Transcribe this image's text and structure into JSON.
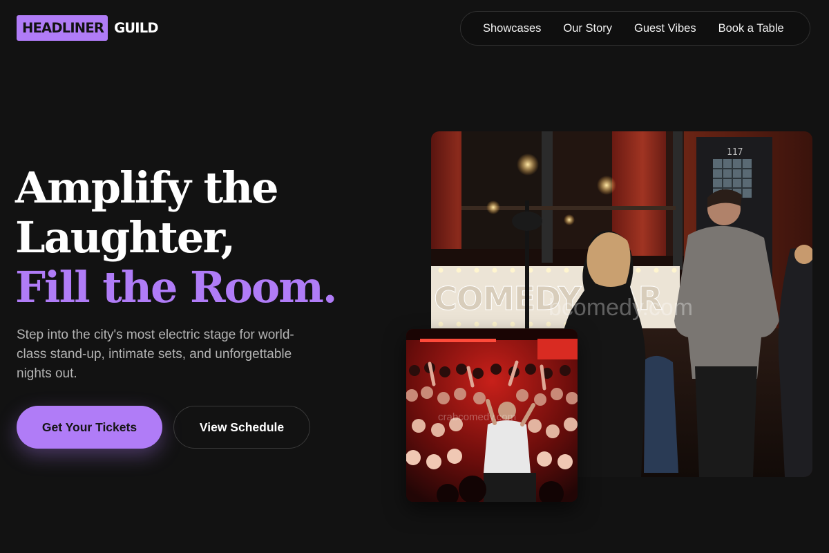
{
  "brand": {
    "highlight": "HEADLINER",
    "name": "GUILD",
    "accent_color": "#b07cf7"
  },
  "nav": {
    "items": [
      {
        "label": "Showcases"
      },
      {
        "label": "Our Story"
      },
      {
        "label": "Guest Vibes"
      },
      {
        "label": "Book a Table"
      }
    ]
  },
  "hero": {
    "title_line_1": "Amplify the",
    "title_line_2": "Laughter,",
    "title_line_3": "Fill the Room.",
    "subtitle": "Step into the city's most electric stage for world-class stand-up, intimate sets, and unforgettable nights out.",
    "primary_cta": "Get Your Tickets",
    "secondary_cta": "View Schedule"
  },
  "images": {
    "main_sign_text": "COMEDY BAR",
    "door_number": "117",
    "main_watermark": "bcomedy.com",
    "crowd_watermark": "crabcomedy.com"
  }
}
